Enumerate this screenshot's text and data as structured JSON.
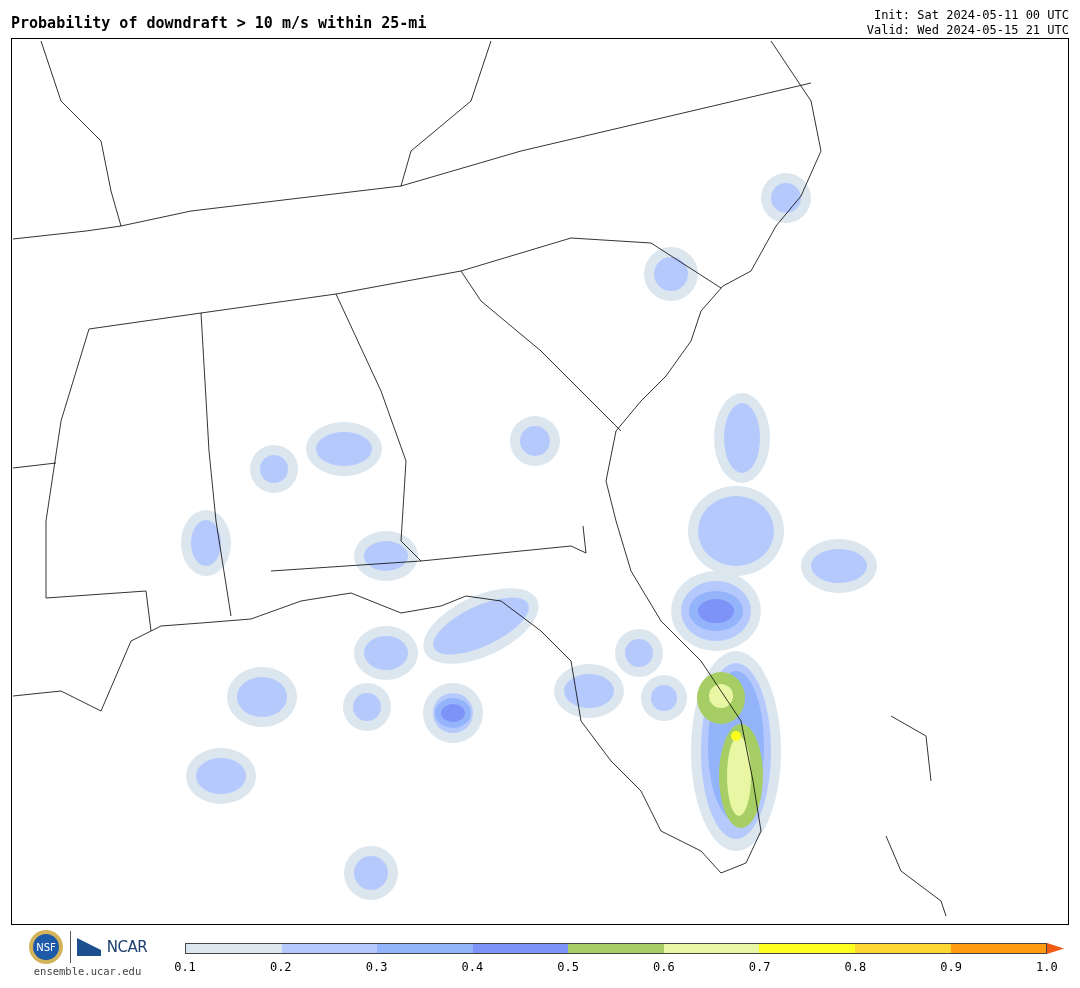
{
  "title": "Probability of downdraft > 10 m/s within 25-mi",
  "init": "Init: Sat 2024-05-11 00 UTC",
  "valid": "Valid: Wed 2024-05-15 21 UTC",
  "logo": {
    "nsf": "NSF",
    "ncar": "NCAR",
    "site": "ensemble.ucar.edu"
  },
  "colorbar": {
    "bins": [
      {
        "color": "#dce6ef"
      },
      {
        "color": "#b5c9fd"
      },
      {
        "color": "#93b4fb"
      },
      {
        "color": "#7d93f8"
      },
      {
        "color": "#a6ce64"
      },
      {
        "color": "#e9f6a4"
      },
      {
        "color": "#fefe1e"
      },
      {
        "color": "#ffd532"
      },
      {
        "color": "#ff9b12"
      }
    ],
    "extend": {
      "color": "#f05a12"
    },
    "ticks": [
      "0.1",
      "0.2",
      "0.3",
      "0.4",
      "0.5",
      "0.6",
      "0.7",
      "0.8",
      "0.9",
      "1.0"
    ]
  }
}
